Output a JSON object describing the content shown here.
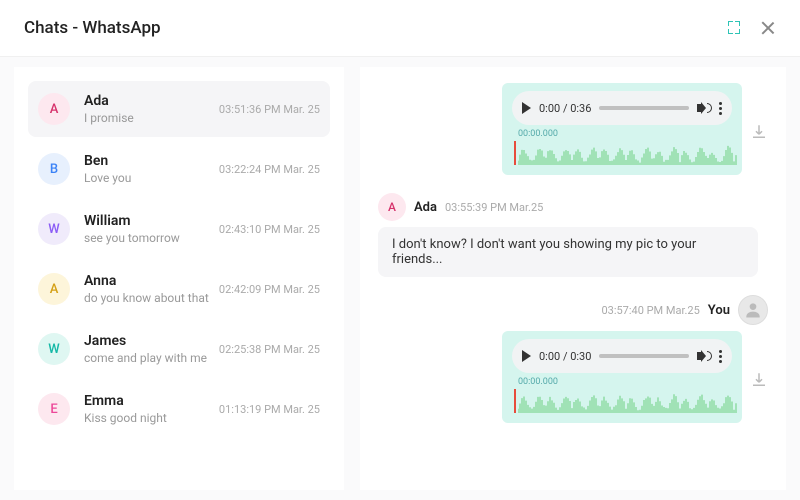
{
  "header": {
    "title": "Chats - WhatsApp"
  },
  "avatarColors": {
    "A_pink": {
      "bg": "#fde8ef",
      "fg": "#d6336c"
    },
    "B_blue": {
      "bg": "#e7f0fd",
      "fg": "#3b82f6"
    },
    "W_purple": {
      "bg": "#f0ebfb",
      "fg": "#8b5cf6"
    },
    "A_yellow": {
      "bg": "#fdf5da",
      "fg": "#d4a017"
    },
    "W_teal": {
      "bg": "#dff7f2",
      "fg": "#14b8a6"
    },
    "E_pink": {
      "bg": "#fde8ef",
      "fg": "#ec4899"
    }
  },
  "chats": [
    {
      "initial": "A",
      "name": "Ada",
      "preview": "I promise",
      "time": "03:51:36 PM Mar. 25",
      "color": "A_pink",
      "selected": true
    },
    {
      "initial": "B",
      "name": "Ben",
      "preview": "Love you",
      "time": "03:22:24 PM Mar. 25",
      "color": "B_blue",
      "selected": false
    },
    {
      "initial": "W",
      "name": "William",
      "preview": "see you tomorrow",
      "time": "02:43:10 PM Mar. 25",
      "color": "W_purple",
      "selected": false
    },
    {
      "initial": "A",
      "name": "Anna",
      "preview": "do you know about that",
      "time": "02:42:09 PM Mar. 25",
      "color": "A_yellow",
      "selected": false
    },
    {
      "initial": "W",
      "name": "James",
      "preview": "come and play with me",
      "time": "02:25:38 PM Mar. 25",
      "color": "W_teal",
      "selected": false
    },
    {
      "initial": "E",
      "name": "Emma",
      "preview": "Kiss good night",
      "time": "01:13:19 PM Mar. 25",
      "color": "E_pink",
      "selected": false
    }
  ],
  "conversation": {
    "contact": {
      "initial": "A",
      "name": "Ada",
      "color": "A_pink"
    },
    "self_label": "You",
    "messages": [
      {
        "from": "self",
        "type": "audio",
        "duration": "0:36",
        "current": "0:00",
        "waveform_ts": "00:00.000"
      },
      {
        "from": "contact",
        "type": "text",
        "time": "03:55:39 PM Mar.25",
        "text": "I don't know? I don't want you showing my pic to your friends..."
      },
      {
        "from": "self",
        "type": "audio",
        "time": "03:57:40 PM Mar.25",
        "duration": "0:30",
        "current": "0:00",
        "waveform_ts": "00:00.000"
      }
    ]
  }
}
